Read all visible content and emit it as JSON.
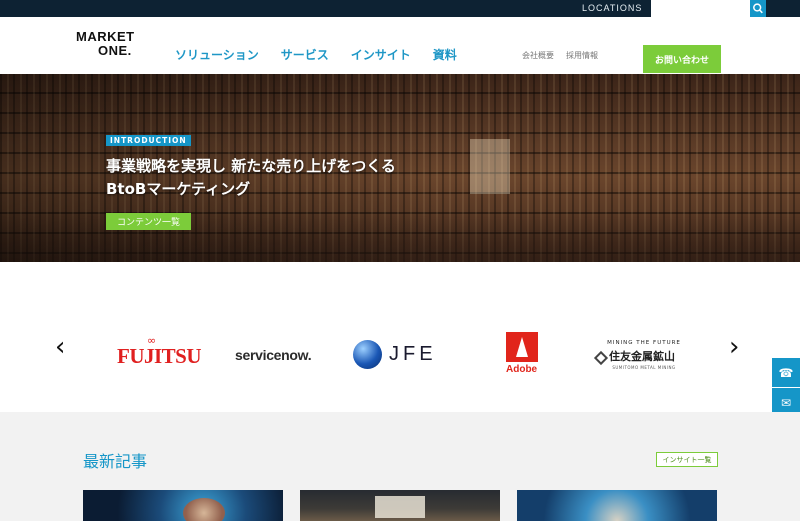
{
  "topbar": {
    "locations_label": "LOCATIONS",
    "search_placeholder": ""
  },
  "header": {
    "logo_line1": "MARKET",
    "logo_line2": "ONE.",
    "nav": [
      "ソリューション",
      "サービス",
      "インサイト",
      "資料"
    ],
    "subnav": [
      "会社概要",
      "採用情報"
    ],
    "contact_label": "お問い合わせ"
  },
  "hero": {
    "tag": "INTRODUCTION",
    "title_line1": "事業戦略を実現し 新たな売り上げをつくる",
    "title_line2": "BtoBマーケティング",
    "button_label": "コンテンツ一覧"
  },
  "carousel": {
    "prev": "‹",
    "next": "›",
    "logos": {
      "fujitsu": "FUJITSU",
      "servicenow": "servicenow.",
      "jfe": "JFE",
      "adobe": "Adobe",
      "sumitomo_top": "MINING THE FUTURE",
      "sumitomo_main": "住友金属鉱山",
      "sumitomo_bottom": "SUMITOMO METAL MINING"
    }
  },
  "side": {
    "phone_icon": "☎",
    "mail_icon": "✉"
  },
  "news": {
    "title": "最新記事",
    "link_label": "インサイト一覧"
  },
  "colors": {
    "accent_blue": "#1596c8",
    "accent_green": "#7ccc3a",
    "topbar": "#0d2233"
  }
}
